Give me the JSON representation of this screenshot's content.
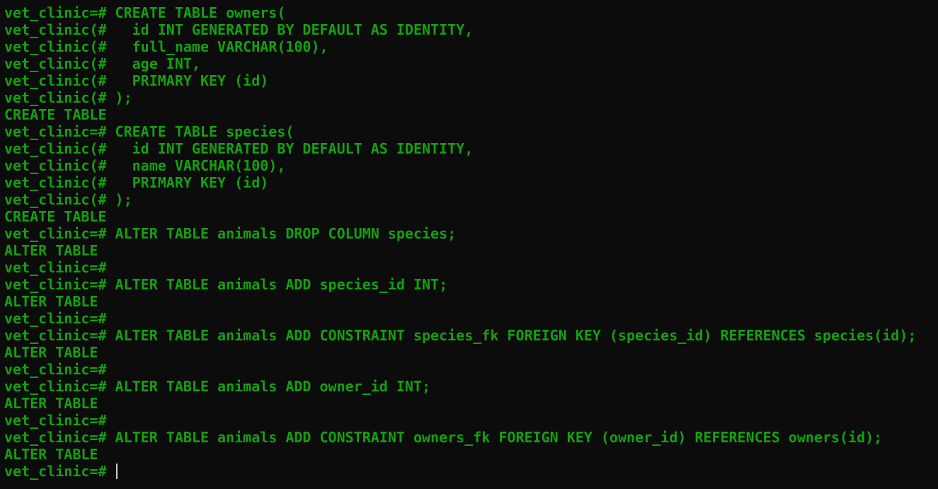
{
  "terminal": {
    "lines": [
      "vet_clinic=# CREATE TABLE owners(",
      "vet_clinic(#   id INT GENERATED BY DEFAULT AS IDENTITY,",
      "vet_clinic(#   full_name VARCHAR(100),",
      "vet_clinic(#   age INT,",
      "vet_clinic(#   PRIMARY KEY (id)",
      "vet_clinic(# );",
      "CREATE TABLE",
      "vet_clinic=# CREATE TABLE species(",
      "vet_clinic(#   id INT GENERATED BY DEFAULT AS IDENTITY,",
      "vet_clinic(#   name VARCHAR(100),",
      "vet_clinic(#   PRIMARY KEY (id)",
      "vet_clinic(# );",
      "CREATE TABLE",
      "vet_clinic=# ALTER TABLE animals DROP COLUMN species;",
      "ALTER TABLE",
      "vet_clinic=#",
      "vet_clinic=# ALTER TABLE animals ADD species_id INT;",
      "ALTER TABLE",
      "vet_clinic=#",
      "vet_clinic=# ALTER TABLE animals ADD CONSTRAINT species_fk FOREIGN KEY (species_id) REFERENCES species(id);",
      "ALTER TABLE",
      "vet_clinic=#",
      "vet_clinic=# ALTER TABLE animals ADD owner_id INT;",
      "ALTER TABLE",
      "vet_clinic=#",
      "vet_clinic=# ALTER TABLE animals ADD CONSTRAINT owners_fk FOREIGN KEY (owner_id) REFERENCES owners(id);",
      "ALTER TABLE"
    ],
    "prompt": "vet_clinic=# "
  },
  "colors": {
    "background": "#0c0c0c",
    "text": "#13a10e",
    "cursor": "#cccccc"
  }
}
